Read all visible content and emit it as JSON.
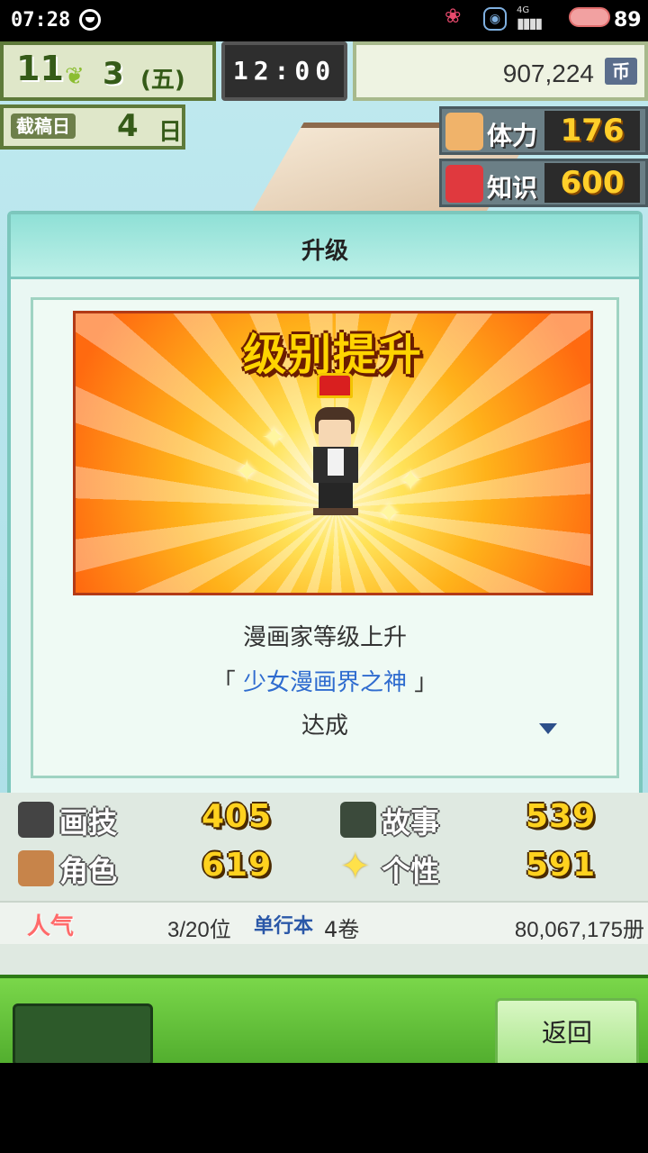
{
  "status_bar": {
    "time": "07:28",
    "network": "4G",
    "battery": "89"
  },
  "hud": {
    "month": "11",
    "week": "3",
    "weekday": "(五)",
    "clock": "12:00",
    "money": "907,224",
    "currency_icon": "币",
    "deadline_label": "截稿日",
    "deadline_days": "4",
    "deadline_unit": "日",
    "stamina_label": "体力",
    "stamina_value": "176",
    "knowledge_label": "知识",
    "knowledge_value": "600"
  },
  "dialog": {
    "title": "升级",
    "banner_headline": "级别提升",
    "line1": "漫画家等级上升",
    "bracket_open": "「",
    "rank_name": "少女漫画界之神",
    "bracket_close": "」",
    "line3": "达成"
  },
  "stats": {
    "art_label": "画技",
    "art_value": "405",
    "story_label": "故事",
    "story_value": "539",
    "character_label": "角色",
    "character_value": "619",
    "personality_label": "个性",
    "personality_value": "591",
    "popularity_label": "人气",
    "rank": "3/20位",
    "volumes_label": "单行本",
    "volumes": "4卷",
    "sales": "80,067,175册"
  },
  "buttons": {
    "back": "返回"
  },
  "colors": {
    "accent_green": "#5fc33a",
    "rank_blue": "#2f6ccf",
    "stat_gold": "#ffd21f"
  }
}
